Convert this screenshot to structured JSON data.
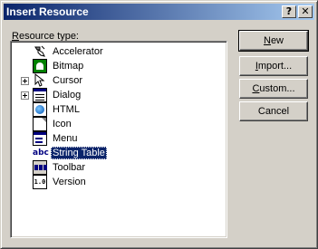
{
  "window": {
    "title": "Insert Resource",
    "help_glyph": "?",
    "close_glyph": "✕"
  },
  "resource_type_label": {
    "mnemonic": "R",
    "rest": "esource type:"
  },
  "tree": {
    "items": [
      {
        "label": "Accelerator",
        "icon": "accelerator-icon",
        "expandable": false,
        "selected": false
      },
      {
        "label": "Bitmap",
        "icon": "bitmap-icon",
        "expandable": false,
        "selected": false
      },
      {
        "label": "Cursor",
        "icon": "cursor-icon",
        "expandable": true,
        "selected": false
      },
      {
        "label": "Dialog",
        "icon": "dialog-icon",
        "expandable": true,
        "selected": false
      },
      {
        "label": "HTML",
        "icon": "html-icon",
        "expandable": false,
        "selected": false
      },
      {
        "label": "Icon",
        "icon": "icon-resource-icon",
        "expandable": false,
        "selected": false
      },
      {
        "label": "Menu",
        "icon": "menu-icon",
        "expandable": false,
        "selected": false
      },
      {
        "label": "String Table",
        "icon": "string-table-icon",
        "expandable": false,
        "selected": true
      },
      {
        "label": "Toolbar",
        "icon": "toolbar-icon",
        "expandable": false,
        "selected": false
      },
      {
        "label": "Version",
        "icon": "version-icon",
        "expandable": false,
        "selected": false
      }
    ],
    "string_icon_text": "abc",
    "version_icon_text": "1.0"
  },
  "buttons": {
    "new": {
      "mnemonic": "N",
      "rest": "ew"
    },
    "import": {
      "mnemonic": "I",
      "rest": "mport..."
    },
    "custom": {
      "mnemonic": "C",
      "rest": "ustom..."
    },
    "cancel": {
      "label": "Cancel"
    }
  },
  "colors": {
    "title_start": "#0a246a",
    "title_end": "#a6caf0",
    "selection": "#0a246a",
    "face": "#d4d0c8"
  }
}
